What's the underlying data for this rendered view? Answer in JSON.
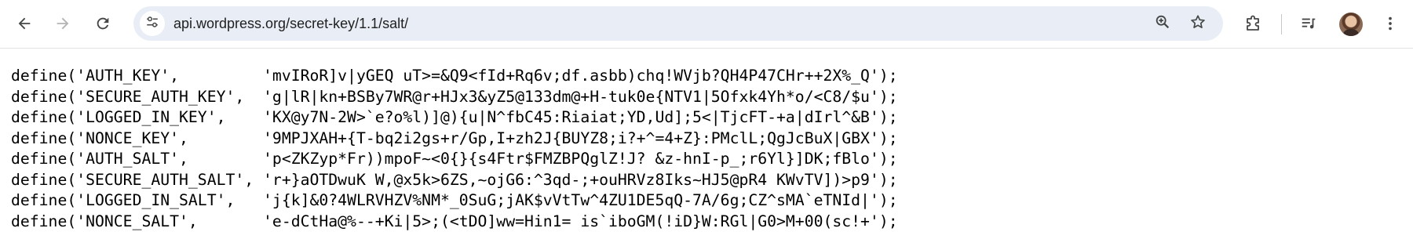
{
  "browser": {
    "url": "api.wordpress.org/secret-key/1.1/salt/",
    "icons": {
      "back": "arrow-left-icon",
      "forward": "arrow-right-icon",
      "reload": "reload-icon",
      "site_info": "tune-icon",
      "zoom": "zoom-in-icon",
      "bookmark": "star-icon",
      "extensions": "puzzle-icon",
      "media": "playlist-icon",
      "menu": "kebab-menu-icon"
    }
  },
  "page": {
    "lines": [
      "define('AUTH_KEY',         'mvIRoR]v|yGEQ uT>=&Q9<fId+Rq6v;df.asbb)chq!WVjb?QH4P47CHr++2X%_Q');",
      "define('SECURE_AUTH_KEY',  'g|lR|kn+BSBy7WR@r+HJx3&yZ5@133dm@+H-tuk0e{NTV1|5Ofxk4Yh*o/<C8/$u');",
      "define('LOGGED_IN_KEY',    'KX@y7N-2W>`e?o%l)]@){u|N^fbC45:Riaiat;YD,Ud];5<|TjcFT-+a|dIrl^&B');",
      "define('NONCE_KEY',        '9MPJXAH+{T-bq2i2gs+r/Gp,I+zh2J{BUYZ8;i?+^=4+Z}:PMclL;QgJcBuX|GBX');",
      "define('AUTH_SALT',        'p<ZKZyp*Fr))mpoF~<0{}{s4Ftr$FMZBPQglZ!J? &z-hnI-p_;r6Yl}]DK;fBlo');",
      "define('SECURE_AUTH_SALT', 'r+}aOTDwuK W,@x5k>6ZS,~ojG6:^3qd-;+ouHRVz8Iks~HJ5@pR4 KWvTV])>p9');",
      "define('LOGGED_IN_SALT',   'j{k]&0?4WLRVHZV%NM*_0SuG;jAK$vVtTw^4ZU1DE5qQ-7A/6g;CZ^sMA`eTNId|');",
      "define('NONCE_SALT',       'e-dCtHa@%--+Ki|5>;(<tDO]ww=Hin1= is`iboGM(!iD}W:RGl|G0>M+00(sc!+');"
    ]
  }
}
